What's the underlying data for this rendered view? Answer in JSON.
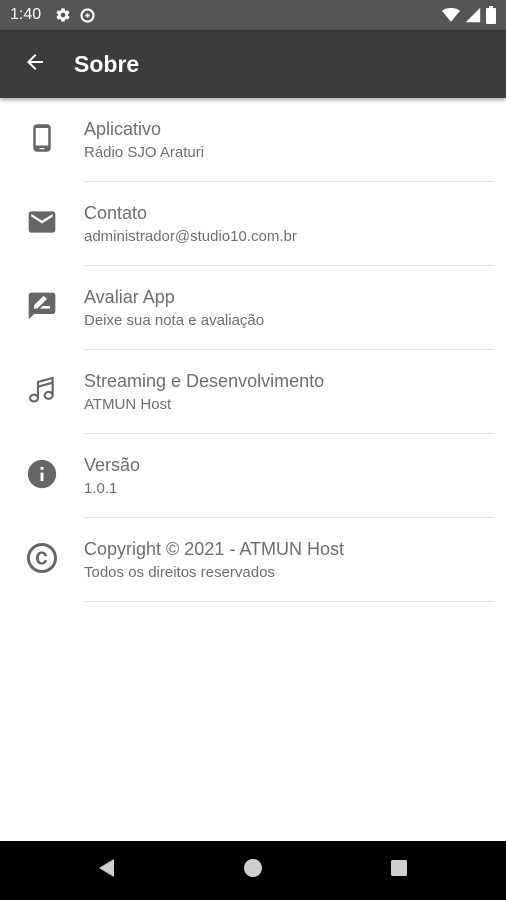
{
  "status_bar": {
    "time": "1:40",
    "left_icons": [
      "settings-icon",
      "data-saver-icon"
    ],
    "right_icons": [
      "wifi-icon",
      "signal-icon",
      "battery-icon"
    ]
  },
  "app_bar": {
    "title": "Sobre",
    "back_icon": "arrow-back-icon"
  },
  "items": [
    {
      "icon": "smartphone-icon",
      "title": "Aplicativo",
      "subtitle": "Rádio SJO Araturi"
    },
    {
      "icon": "mail-icon",
      "title": "Contato",
      "subtitle": "administrador@studio10.com.br"
    },
    {
      "icon": "rate-review-icon",
      "title": "Avaliar App",
      "subtitle": "Deixe sua nota e avaliação"
    },
    {
      "icon": "music-note-icon",
      "title": "Streaming e Desenvolvimento",
      "subtitle": "ATMUN Host"
    },
    {
      "icon": "info-icon",
      "title": "Versão",
      "subtitle": "1.0.1"
    },
    {
      "icon": "copyright-icon",
      "title": "Copyright © 2021 - ATMUN Host",
      "subtitle": "Todos os direitos reservados"
    }
  ],
  "nav_bar": {
    "buttons": [
      "back-triangle-icon",
      "home-circle-icon",
      "recents-square-icon"
    ]
  },
  "colors": {
    "status_bar": "#555555",
    "app_bar": "#3b3b3b",
    "text": "#6e6e6e",
    "icon": "#666666",
    "nav_bar": "#000000"
  }
}
